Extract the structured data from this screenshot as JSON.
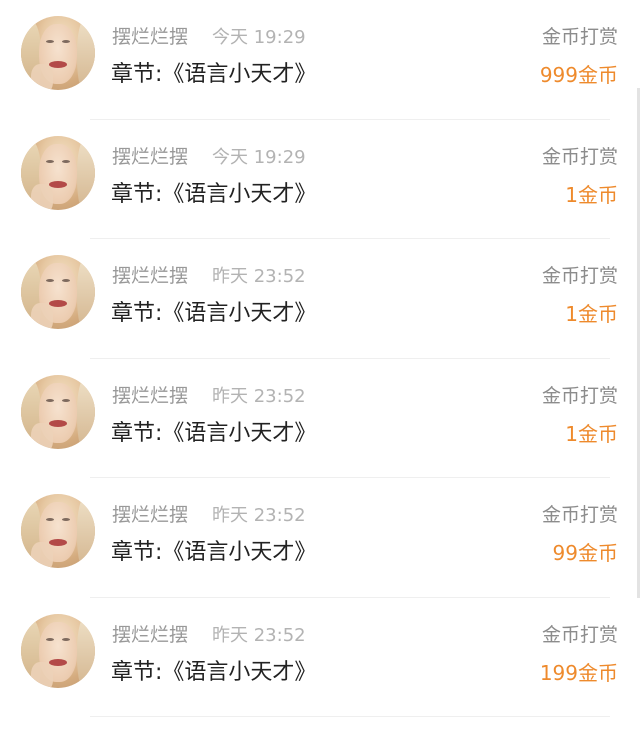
{
  "items": [
    {
      "name": "摆烂烂摆",
      "time": "今天 19:29",
      "chapter": "章节:《语言小天才》",
      "label": "金币打赏",
      "amount": "999金币"
    },
    {
      "name": "摆烂烂摆",
      "time": "今天 19:29",
      "chapter": "章节:《语言小天才》",
      "label": "金币打赏",
      "amount": "1金币"
    },
    {
      "name": "摆烂烂摆",
      "time": "昨天 23:52",
      "chapter": "章节:《语言小天才》",
      "label": "金币打赏",
      "amount": "1金币"
    },
    {
      "name": "摆烂烂摆",
      "time": "昨天 23:52",
      "chapter": "章节:《语言小天才》",
      "label": "金币打赏",
      "amount": "1金币"
    },
    {
      "name": "摆烂烂摆",
      "time": "昨天 23:52",
      "chapter": "章节:《语言小天才》",
      "label": "金币打赏",
      "amount": "99金币"
    },
    {
      "name": "摆烂烂摆",
      "time": "昨天 23:52",
      "chapter": "章节:《语言小天才》",
      "label": "金币打赏",
      "amount": "199金币"
    }
  ],
  "colors": {
    "amount": "#ee8a2c",
    "name": "#999999",
    "chapter": "#222222"
  }
}
